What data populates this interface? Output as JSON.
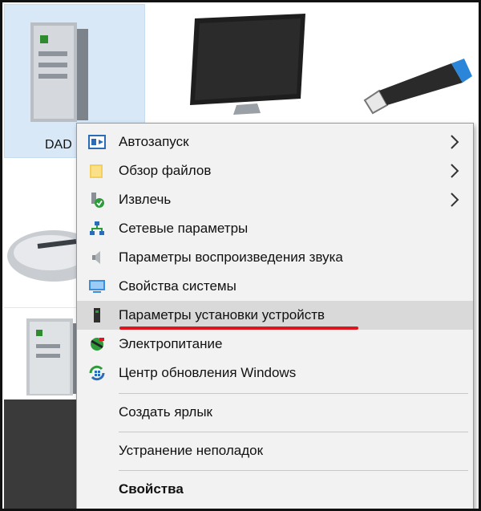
{
  "desktop": {
    "selected_device_label": "DAD"
  },
  "menu": {
    "items": [
      {
        "label": "Автозапуск",
        "icon": "autoplay-icon",
        "submenu": true
      },
      {
        "label": "Обзор файлов",
        "icon": "folder-icon",
        "submenu": true
      },
      {
        "label": "Извлечь",
        "icon": "eject-icon",
        "submenu": true
      },
      {
        "label": "Сетевые параметры",
        "icon": "network-icon",
        "submenu": false
      },
      {
        "label": "Параметры воспроизведения звука",
        "icon": "speaker-icon",
        "submenu": false
      },
      {
        "label": "Свойства системы",
        "icon": "monitor-icon",
        "submenu": false
      },
      {
        "label": "Параметры установки устройств",
        "icon": "device-install-icon",
        "submenu": false,
        "highlighted": true
      },
      {
        "label": "Электропитание",
        "icon": "power-icon",
        "submenu": false
      },
      {
        "label": "Центр обновления Windows",
        "icon": "windows-update-icon",
        "submenu": false
      },
      {
        "label": "Создать ярлык",
        "submenu": false
      },
      {
        "label": "Устранение неполадок",
        "submenu": false
      },
      {
        "label": "Свойства",
        "submenu": false,
        "bold": true
      }
    ]
  },
  "colors": {
    "highlight": "#d9d9d9",
    "annotation_underline": "#e0141c",
    "selection": "#d9e8f7"
  }
}
